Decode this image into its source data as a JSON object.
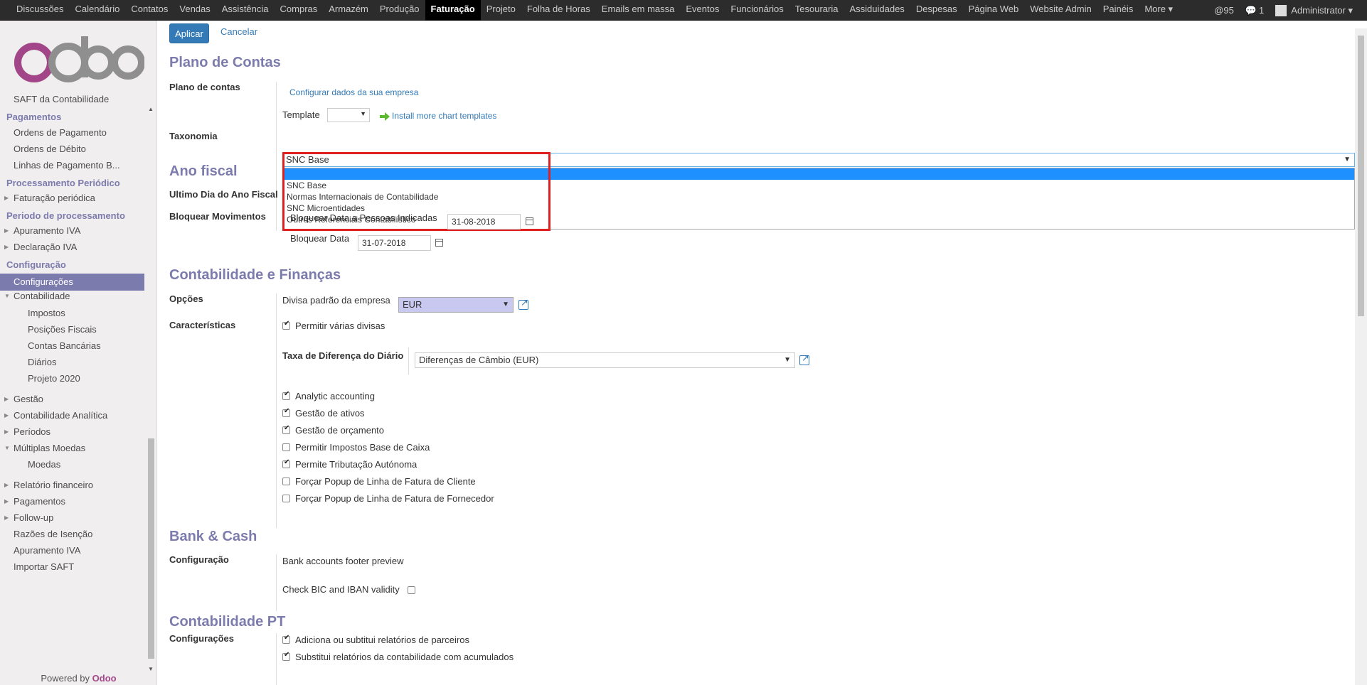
{
  "topnav": {
    "items": [
      "Discussões",
      "Calendário",
      "Contatos",
      "Vendas",
      "Assistência",
      "Compras",
      "Armazém",
      "Produção",
      "Faturação",
      "Projeto",
      "Folha de Horas",
      "Emails em massa",
      "Eventos",
      "Funcionários",
      "Tesouraria",
      "Assiduidades",
      "Despesas",
      "Página Web",
      "Website Admin",
      "Painéis",
      "More ▾"
    ],
    "active": "Faturação",
    "mentions": "95",
    "messages": "1",
    "user": "Administrator ▾"
  },
  "sidebar": {
    "items": [
      {
        "text": "SAFT da Contabilidade"
      },
      {
        "text": "Pagamentos"
      },
      {
        "text": "Ordens de Pagamento"
      },
      {
        "text": "Ordens de Débito"
      },
      {
        "text": "Linhas de Pagamento B..."
      },
      {
        "text": "Processamento Periódico"
      },
      {
        "text": "Faturação periódica"
      },
      {
        "text": "Periodo de processamento"
      },
      {
        "text": "Apuramento IVA"
      },
      {
        "text": "Declaração IVA"
      },
      {
        "text": "Configuração"
      },
      {
        "text": "Configurações"
      },
      {
        "text": "Contabilidade"
      },
      {
        "text": "Impostos"
      },
      {
        "text": "Posições Fiscais"
      },
      {
        "text": "Contas Bancárias"
      },
      {
        "text": "Diários"
      },
      {
        "text": "Projeto 2020"
      },
      {
        "text": "Gestão"
      },
      {
        "text": "Contabilidade Analítica"
      },
      {
        "text": "Períodos"
      },
      {
        "text": "Múltiplas Moedas"
      },
      {
        "text": "Moedas"
      },
      {
        "text": "Relatório financeiro"
      },
      {
        "text": "Pagamentos"
      },
      {
        "text": "Follow-up"
      },
      {
        "text": "Razões de Isenção"
      },
      {
        "text": "Apuramento IVA"
      },
      {
        "text": "Importar SAFT"
      }
    ],
    "powered_prefix": "Powered by ",
    "powered_brand": "Odoo"
  },
  "buttons": {
    "apply": "Aplicar",
    "cancel": "Cancelar"
  },
  "plano": {
    "title": "Plano de Contas",
    "label": "Plano de contas",
    "configure_link": "Configurar dados da sua empresa",
    "template_label": "Template",
    "install_link": "Install more chart templates",
    "tax_label": "Taxonomia",
    "tax_value": "SNC Base",
    "tax_options": [
      "",
      "SNC Base",
      "Normas Internacionais de Contabilidade",
      "SNC Microentidades",
      "Outros Referenciais Contabilístico"
    ]
  },
  "fiscal": {
    "title": "Ano fiscal",
    "last_day_label": "Ultimo Dia do Ano Fiscal",
    "lock_label": "Bloquear Movimentos",
    "lock_people_label": "Bloquear Data a Pessoas Indicadas",
    "lock_people_value": "31-08-2018",
    "lock_date_label": "Bloquear Data",
    "lock_date_value": "31-07-2018"
  },
  "finance": {
    "title": "Contabilidade e Finanças",
    "options_label": "Opções",
    "currency_label": "Divisa padrão da empresa",
    "currency_value": "EUR",
    "features_label": "Características",
    "multi_currency": "Permitir várias divisas",
    "exchange_label": "Taxa de Diferença do Diário",
    "exchange_value": "Diferenças de Câmbio (EUR)",
    "checks": [
      {
        "label": "Analytic accounting",
        "on": true
      },
      {
        "label": "Gestão de ativos",
        "on": true
      },
      {
        "label": "Gestão de orçamento",
        "on": true
      },
      {
        "label": "Permitir Impostos Base de Caixa",
        "on": false
      },
      {
        "label": "Permite Tributação Autónoma",
        "on": true
      },
      {
        "label": "Forçar Popup de Linha de Fatura de Cliente",
        "on": false
      },
      {
        "label": "Forçar Popup de Linha de Fatura de Fornecedor",
        "on": false
      }
    ]
  },
  "bank": {
    "title": "Bank & Cash",
    "config_label": "Configuração",
    "footer_preview": "Bank accounts footer preview",
    "bic_check": "Check BIC and IBAN validity"
  },
  "pt": {
    "title": "Contabilidade PT",
    "config_label": "Configurações",
    "check1": "Adiciona ou subtitui relatórios de parceiros",
    "check2": "Substitui relatórios da contabilidade com acumulados"
  },
  "colors": {
    "accent": "#7c7bad",
    "primary": "#337ab7",
    "highlight": "#e02020"
  }
}
